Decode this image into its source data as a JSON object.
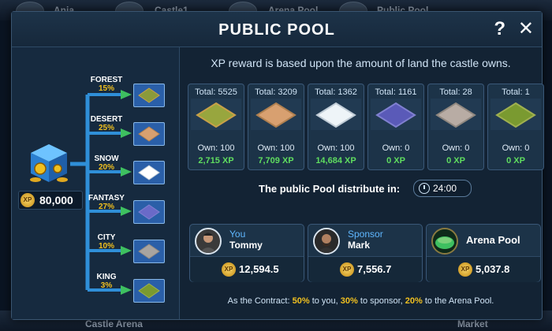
{
  "background": {
    "top_labels": [
      "Ania",
      "Castle1",
      "Arena Pool",
      "Public Pool"
    ],
    "bottom_labels": [
      "Castle Arena",
      "Market"
    ]
  },
  "dialog": {
    "title": "PUBLIC POOL",
    "help_label": "?",
    "close_label": "✕"
  },
  "pool": {
    "total_xp": "80,000",
    "xp_badge": "XP"
  },
  "lands": [
    {
      "name": "FOREST",
      "pct": "15%",
      "color": "#8a9a3a"
    },
    {
      "name": "DESERT",
      "pct": "25%",
      "color": "#d8a070"
    },
    {
      "name": "SNOW",
      "pct": "20%",
      "color": "#ffffff"
    },
    {
      "name": "FANTASY",
      "pct": "27%",
      "color": "#6a6ac8"
    },
    {
      "name": "CITY",
      "pct": "10%",
      "color": "#a8a4a0"
    },
    {
      "name": "KING",
      "pct": "3%",
      "color": "#7a9a30"
    }
  ],
  "reward_text": "XP reward is based upon the amount of land the castle owns.",
  "cards": [
    {
      "total": "Total: 5525",
      "own": "Own: 100",
      "xp": "2,715 XP",
      "color": "#98a63e",
      "edge": "#c8a048"
    },
    {
      "total": "Total: 3209",
      "own": "Own: 100",
      "xp": "7,709 XP",
      "color": "#d8a070",
      "edge": "#b08050"
    },
    {
      "total": "Total: 1362",
      "own": "Own: 100",
      "xp": "14,684 XP",
      "color": "#eef4f8",
      "edge": "#c0ccd6"
    },
    {
      "total": "Total: 1161",
      "own": "Own: 0",
      "xp": "0 XP",
      "color": "#5a5ab8",
      "edge": "#8080d0"
    },
    {
      "total": "Total: 28",
      "own": "Own: 0",
      "xp": "0 XP",
      "color": "#b8aca4",
      "edge": "#908880"
    },
    {
      "total": "Total: 1",
      "own": "Own: 0",
      "xp": "0 XP",
      "color": "#7a9a30",
      "edge": "#a0b050"
    }
  ],
  "distribute": {
    "label": "The public Pool distribute in:",
    "time": "24:00"
  },
  "participants": [
    {
      "role": "You",
      "name": "Tommy",
      "amount": "12,594.5"
    },
    {
      "role": "Sponsor",
      "name": "Mark",
      "amount": "7,556.7"
    },
    {
      "role": "",
      "name": "Arena Pool",
      "amount": "5,037.8"
    }
  ],
  "contract": {
    "prefix": "As the Contract:",
    "p1": "50%",
    "t1": "to you,",
    "p2": "30%",
    "t2": "to sponsor,",
    "p3": "20%",
    "t3": "to the Arena Pool."
  }
}
